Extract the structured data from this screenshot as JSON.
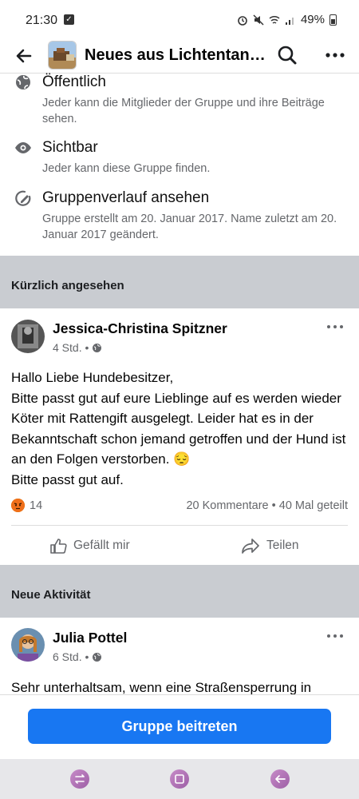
{
  "status_bar": {
    "time": "21:30",
    "battery": "49%"
  },
  "header": {
    "title": "Neues aus Lichtentann…"
  },
  "info": [
    {
      "title": "Öffentlich",
      "desc": "Jeder kann die Mitglieder der Gruppe und ihre Beiträge sehen."
    },
    {
      "title": "Sichtbar",
      "desc": "Jeder kann diese Gruppe finden."
    },
    {
      "title": "Gruppenverlauf ansehen",
      "desc": "Gruppe erstellt am 20. Januar 2017. Name zuletzt am 20. Januar 2017 geändert."
    }
  ],
  "sections": {
    "recent": "Kürzlich angesehen",
    "new_activity": "Neue Aktivität"
  },
  "post1": {
    "author": "Jessica-Christina Spitzner",
    "time": "4 Std. •",
    "text": "Hallo Liebe Hundebesitzer,\nBitte passt gut auf eure Lieblinge auf es werden wieder Köter mit Rattengift ausgelegt. Leider hat es in der Bekanntschaft schon jemand getroffen und der Hund ist an den Folgen verstorben. 😔\nBitte passt gut auf.",
    "reaction_count": "14",
    "stats": "20 Kommentare • 40 Mal geteilt",
    "like_label": "Gefällt mir",
    "share_label": "Teilen"
  },
  "post2": {
    "author": "Julia Pottel",
    "time": "6 Std. •",
    "text": "Sehr unterhaltsam, wenn eine Straßensperrung in"
  },
  "join_button": "Gruppe beitreten",
  "colors": {
    "primary": "#1877f2",
    "section_band": "#c9ccd1",
    "secondary_text": "#65676b"
  }
}
